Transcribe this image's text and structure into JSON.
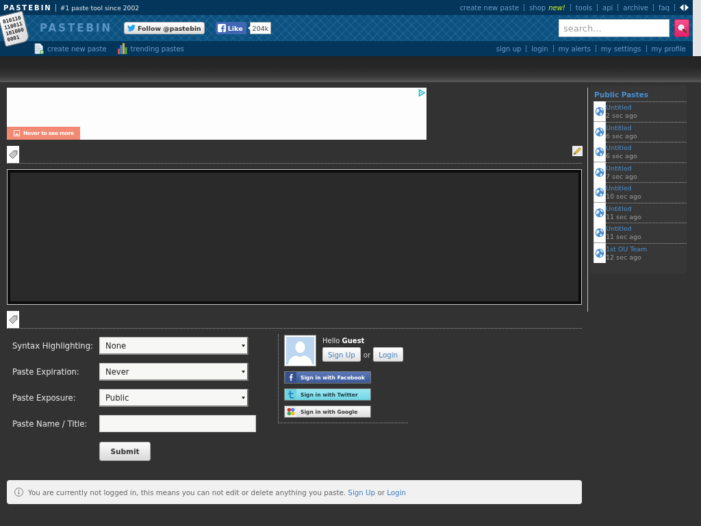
{
  "top_bar": {
    "brand": "PASTEBIN",
    "tagline": "#1 paste tool since 2002",
    "links": [
      {
        "label": "create new paste"
      },
      {
        "label": "shop",
        "badge": "new!"
      },
      {
        "label": "tools"
      },
      {
        "label": "api"
      },
      {
        "label": "archive"
      },
      {
        "label": "faq"
      }
    ]
  },
  "header": {
    "logo_digits": [
      "010110",
      "110011",
      "101000",
      "0001"
    ],
    "site_title": "PASTEBIN",
    "follow_button": "Follow @pastebin",
    "like_button": "Like",
    "like_count": "204k",
    "search": {
      "placeholder": "search..."
    }
  },
  "nav": {
    "links": [
      {
        "kind": "create",
        "label": "create new paste"
      },
      {
        "kind": "trending",
        "label": "trending pastes"
      }
    ],
    "account_links": [
      {
        "label": "sign up"
      },
      {
        "label": "login"
      },
      {
        "label": "my alerts"
      },
      {
        "label": "my settings"
      },
      {
        "label": "my profile"
      }
    ]
  },
  "ad": {
    "button": "Hover to see more"
  },
  "form": {
    "fields": [
      {
        "kind": "select",
        "label": "Syntax Highlighting:",
        "value": "None"
      },
      {
        "kind": "select",
        "label": "Paste Expiration:",
        "value": "Never"
      },
      {
        "kind": "select",
        "label": "Paste Exposure:",
        "value": "Public"
      },
      {
        "kind": "text",
        "label": "Paste Name / Title:"
      }
    ],
    "submit": "Submit"
  },
  "login_box": {
    "greeting": "Hello **Guest**",
    "sign_up": "Sign Up",
    "separator": "or",
    "login": "Login",
    "social": [
      {
        "kind": "facebook",
        "label": "Sign in with Facebook"
      },
      {
        "kind": "twitter",
        "label": "Sign in with Twitter"
      },
      {
        "kind": "google",
        "label": "Sign in with Google"
      }
    ]
  },
  "notice": {
    "text": "You are currently not logged in, this means you can not edit or delete anything you paste.",
    "sign_up": "Sign Up",
    "separator": "or",
    "login": "Login"
  },
  "sidebar": {
    "title": "Public Pastes",
    "items": [
      {
        "title": "Untitled",
        "time": "2 sec ago"
      },
      {
        "title": "Untitled",
        "time": "6 sec ago"
      },
      {
        "title": "Untitled",
        "time": "6 sec ago"
      },
      {
        "title": "Untitled",
        "time": "7 sec ago"
      },
      {
        "title": "Untitled",
        "time": "10 sec ago"
      },
      {
        "title": "Untitled",
        "time": "11 sec ago"
      },
      {
        "title": "Untitled",
        "time": "11 sec ago"
      },
      {
        "title": "1st OU Team",
        "time": "12 sec ago"
      }
    ]
  }
}
